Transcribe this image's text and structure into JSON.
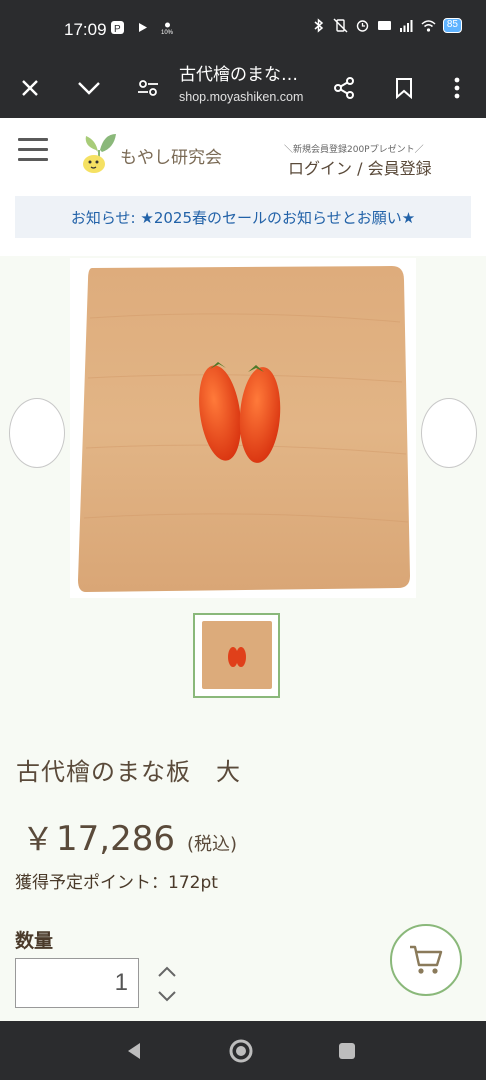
{
  "status_bar": {
    "time": "17:09",
    "battery": "85"
  },
  "browser": {
    "page_title": "古代檜のまな…",
    "url": "shop.moyashiken.com",
    "icons": [
      "close-icon",
      "chevron-down-icon",
      "tune-icon",
      "share-icon",
      "bookmark-icon",
      "more-vert-icon"
    ]
  },
  "header": {
    "logo_text": "もやし研究会",
    "promo_text": "＼新規会員登録200Pプレゼント／",
    "login_link": "ログイン / 会員登録",
    "notice": "お知らせ: ★2025春のセールのお知らせとお願い★"
  },
  "product": {
    "title": "古代檜のまな板　大",
    "price_symbol": "￥",
    "price": "17,286",
    "tax_label": "(税込)",
    "points": "獲得予定ポイント：172pt",
    "quantity_label": "数量",
    "quantity_value": "1"
  },
  "colors": {
    "accent_green": "#8ab87a",
    "text_brown": "#5a4a3a",
    "notice_blue": "#2262a8",
    "bar_dark": "#2b2c2e"
  }
}
